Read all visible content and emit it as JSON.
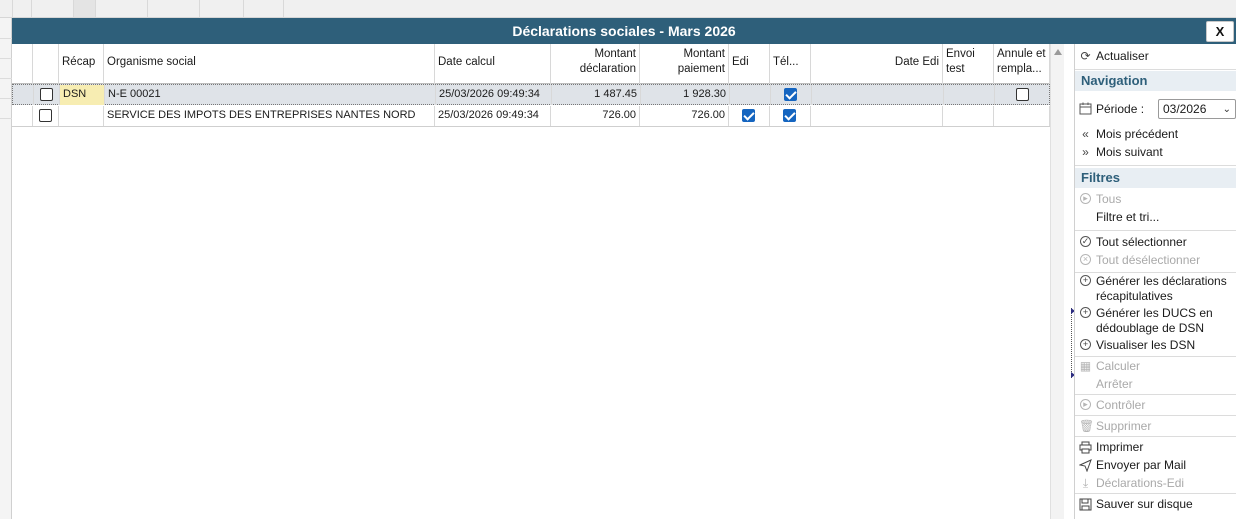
{
  "window": {
    "title": "Déclarations sociales - Mars 2026",
    "close_label": "X"
  },
  "grid": {
    "headers": {
      "recap": "Récap",
      "organisme": "Organisme social",
      "date_calcul": "Date calcul",
      "montant_declaration_1": "Montant",
      "montant_declaration_2": "déclaration",
      "montant_paiement_1": "Montant",
      "montant_paiement_2": "paiement",
      "edi": "Edi",
      "tele": "Tél...",
      "date_edi": "Date Edi",
      "envoi_test_1": "Envoi",
      "envoi_test_2": "test",
      "annule_1": "Annule et",
      "annule_2": "rempla..."
    },
    "rows": [
      {
        "selected": false,
        "recap": "DSN",
        "organisme": "N-E  00021",
        "date_calcul": "25/03/2026 09:49:34",
        "montant_declaration": "1 487.45",
        "montant_paiement": "1 928.30",
        "edi": false,
        "tele": true,
        "date_edi": "",
        "envoi_test": "",
        "annule": false,
        "show_annule": true
      },
      {
        "selected": false,
        "recap": "",
        "organisme": "SERVICE DES IMPOTS DES ENTREPRISES NANTES NORD",
        "date_calcul": "25/03/2026 09:49:34",
        "montant_declaration": "726.00",
        "montant_paiement": "726.00",
        "edi": true,
        "tele": true,
        "date_edi": "",
        "envoi_test": "",
        "annule": false,
        "show_annule": false
      }
    ]
  },
  "panel": {
    "actualiser": "Actualiser",
    "navigation_title": "Navigation",
    "periode_label": "Période :",
    "periode_value": "03/2026",
    "mois_precedent": "Mois précédent",
    "mois_suivant": "Mois suivant",
    "filtres_title": "Filtres",
    "tous": "Tous",
    "filtre_tri": "Filtre et tri...",
    "tout_selectionner": "Tout sélectionner",
    "tout_deselectionner": "Tout désélectionner",
    "generer_recap": "Générer les déclarations récapitulatives",
    "generer_ducs": "Générer les DUCS en dédoublage de DSN",
    "visualiser_dsn": "Visualiser les DSN",
    "calculer": "Calculer",
    "arreter": "Arrêter",
    "controler": "Contrôler",
    "supprimer": "Supprimer",
    "imprimer": "Imprimer",
    "envoyer_mail": "Envoyer par Mail",
    "declarations_edi": "Déclarations-Edi",
    "sauver_disque": "Sauver sur disque"
  }
}
